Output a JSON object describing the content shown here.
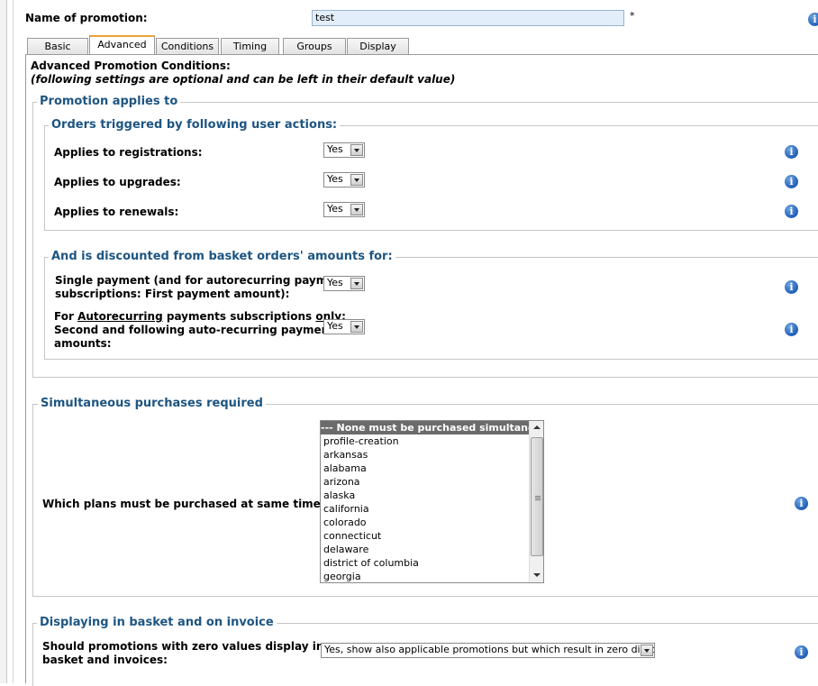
{
  "promotion": {
    "name_label": "Name of promotion:",
    "name_value": "test",
    "required_mark": "*"
  },
  "tabs": [
    {
      "label": "Basic"
    },
    {
      "label": "Advanced"
    },
    {
      "label": "Conditions"
    },
    {
      "label": "Timing"
    },
    {
      "label": "Groups"
    },
    {
      "label": "Display"
    }
  ],
  "active_tab": "Advanced",
  "header": {
    "title": "Advanced Promotion Conditions:",
    "subtitle": "(following settings are optional and can be left in their default value)"
  },
  "applies": {
    "legend": "Promotion applies to",
    "orders": {
      "legend": "Orders triggered by following user actions:",
      "registrations": {
        "label": "Applies to registrations:",
        "value": "Yes"
      },
      "upgrades": {
        "label": "Applies to upgrades:",
        "value": "Yes"
      },
      "renewals": {
        "label": "Applies to renewals:",
        "value": "Yes"
      }
    },
    "discount": {
      "legend": "And is discounted from basket orders' amounts for:",
      "single": {
        "label_line1": "Single payment (and for autorecurring payments",
        "label_line2": "subscriptions: First payment amount):",
        "value": "Yes"
      },
      "recurring": {
        "label_prefix": "For ",
        "label_link": "Autorecurring",
        "label_mid": " payments subscriptions ",
        "label_only": "only",
        "label_suffix": ":",
        "label_line2": "Second and following auto-recurring payments",
        "label_line3": "amounts:",
        "value": "Yes"
      }
    }
  },
  "simultaneous": {
    "legend": "Simultaneous purchases required",
    "label": "Which plans must be purchased at same time:",
    "options": [
      "--- None must be purchased simultaneously ---",
      "profile-creation",
      "arkansas",
      "alabama",
      "arizona",
      "alaska",
      "california",
      "colorado",
      "connecticut",
      "delaware",
      "district of columbia",
      "georgia"
    ]
  },
  "display": {
    "legend": "Displaying in basket and on invoice",
    "label_line1": "Should promotions with zero values display in",
    "label_line2": "basket and invoices:",
    "value": "Yes, show also applicable promotions but which result in zero discount"
  },
  "info_icon": "info-icon",
  "colors": {
    "legend": "#1d5582",
    "input_bg": "#e3eefb",
    "active_tab": "#e8a43a",
    "info_icon": "#1f5fb8"
  }
}
